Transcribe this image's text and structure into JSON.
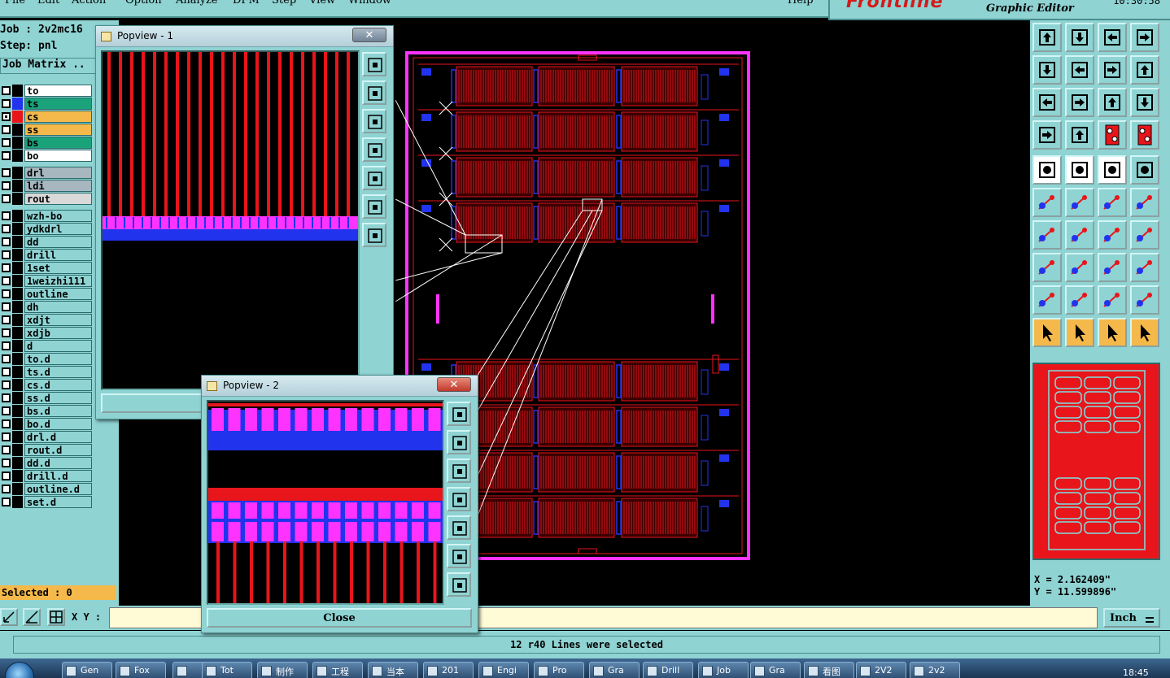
{
  "menubar": {
    "items": [
      "File",
      "Edit",
      "Action",
      "Option",
      "Analyze",
      "DFM",
      "Step",
      "View",
      "Window",
      "Help"
    ]
  },
  "header": {
    "logo": "Frontline",
    "subtitle": "Graphic Editor",
    "time": "10:30:58"
  },
  "job": {
    "job_label": "Job : 2v2mc16",
    "step_label": "Step: pnl",
    "matrix_button": "Job Matrix .."
  },
  "layers": [
    {
      "name": "to",
      "color": "#ffffff",
      "swatch": "#000000",
      "checked": false
    },
    {
      "name": "ts",
      "color": "#1aa37a",
      "swatch": "#2233ee",
      "checked": false
    },
    {
      "name": "cs",
      "color": "#f4b94a",
      "swatch": "#e8151b",
      "checked": true
    },
    {
      "name": "ss",
      "color": "#f4b94a",
      "swatch": "#000000",
      "checked": false
    },
    {
      "name": "bs",
      "color": "#1aa37a",
      "swatch": "#000000",
      "checked": false
    },
    {
      "name": "bo",
      "color": "#ffffff",
      "swatch": "#000000",
      "checked": false
    },
    {
      "name": "drl",
      "color": "#a7b7bf",
      "swatch": "#000000",
      "checked": false
    },
    {
      "name": "ldi",
      "color": "#a7b7bf",
      "swatch": "#000000",
      "checked": false
    },
    {
      "name": "rout",
      "color": "#d9d9d9",
      "swatch": "#000000",
      "checked": false
    },
    {
      "name": "wzh-bo",
      "color": "#8fd3d3",
      "swatch": "#000000",
      "checked": false
    },
    {
      "name": "ydkdrl",
      "color": "#8fd3d3",
      "swatch": "#000000",
      "checked": false
    },
    {
      "name": "dd",
      "color": "#8fd3d3",
      "swatch": "#000000",
      "checked": false
    },
    {
      "name": "drill",
      "color": "#8fd3d3",
      "swatch": "#000000",
      "checked": false
    },
    {
      "name": "1set",
      "color": "#8fd3d3",
      "swatch": "#000000",
      "checked": false
    },
    {
      "name": "1weizhi111",
      "color": "#8fd3d3",
      "swatch": "#000000",
      "checked": false
    },
    {
      "name": "outline",
      "color": "#8fd3d3",
      "swatch": "#000000",
      "checked": false
    },
    {
      "name": "dh",
      "color": "#8fd3d3",
      "swatch": "#000000",
      "checked": false
    },
    {
      "name": "xdjt",
      "color": "#8fd3d3",
      "swatch": "#000000",
      "checked": false
    },
    {
      "name": "xdjb",
      "color": "#8fd3d3",
      "swatch": "#000000",
      "checked": false
    },
    {
      "name": "d",
      "color": "#8fd3d3",
      "swatch": "#000000",
      "checked": false
    },
    {
      "name": "to.d",
      "color": "#8fd3d3",
      "swatch": "#000000",
      "checked": false
    },
    {
      "name": "ts.d",
      "color": "#8fd3d3",
      "swatch": "#000000",
      "checked": false
    },
    {
      "name": "cs.d",
      "color": "#8fd3d3",
      "swatch": "#000000",
      "checked": false
    },
    {
      "name": "ss.d",
      "color": "#8fd3d3",
      "swatch": "#000000",
      "checked": false
    },
    {
      "name": "bs.d",
      "color": "#8fd3d3",
      "swatch": "#000000",
      "checked": false
    },
    {
      "name": "bo.d",
      "color": "#8fd3d3",
      "swatch": "#000000",
      "checked": false
    },
    {
      "name": "drl.d",
      "color": "#8fd3d3",
      "swatch": "#000000",
      "checked": false
    },
    {
      "name": "rout.d",
      "color": "#8fd3d3",
      "swatch": "#000000",
      "checked": false
    },
    {
      "name": "dd.d",
      "color": "#8fd3d3",
      "swatch": "#000000",
      "checked": false
    },
    {
      "name": "drill.d",
      "color": "#8fd3d3",
      "swatch": "#000000",
      "checked": false
    },
    {
      "name": "outline.d",
      "color": "#8fd3d3",
      "swatch": "#000000",
      "checked": false
    },
    {
      "name": "set.d",
      "color": "#8fd3d3",
      "swatch": "#000000",
      "checked": false
    }
  ],
  "selected_label": "Selected : 0",
  "xy": {
    "label": "X Y :",
    "value": "",
    "unit": "Inch"
  },
  "status_message": "12 r40 Lines were selected",
  "coords": {
    "x": "X = 2.162409\"",
    "y": "Y = 11.599896\""
  },
  "popview1": {
    "title": "Popview - 1",
    "close_x": "✕"
  },
  "popview2": {
    "title": "Popview - 2",
    "close_x": "✕",
    "close_button": "Close"
  },
  "taskbar": {
    "items": [
      "Gen",
      "Fox",
      "",
      "Tot",
      "制作",
      "工程",
      "当本",
      "201",
      "Engi",
      "Pro",
      "Gra",
      "Drill",
      "Job",
      "Gra",
      "看图",
      "2V2",
      "2v2"
    ],
    "time": "18:45"
  },
  "colors": {
    "panel": "#8fd3d3",
    "copper": "#e8151b",
    "mask": "#ff33ff",
    "pad": "#2233ee",
    "highlight": "#f4b94a"
  }
}
